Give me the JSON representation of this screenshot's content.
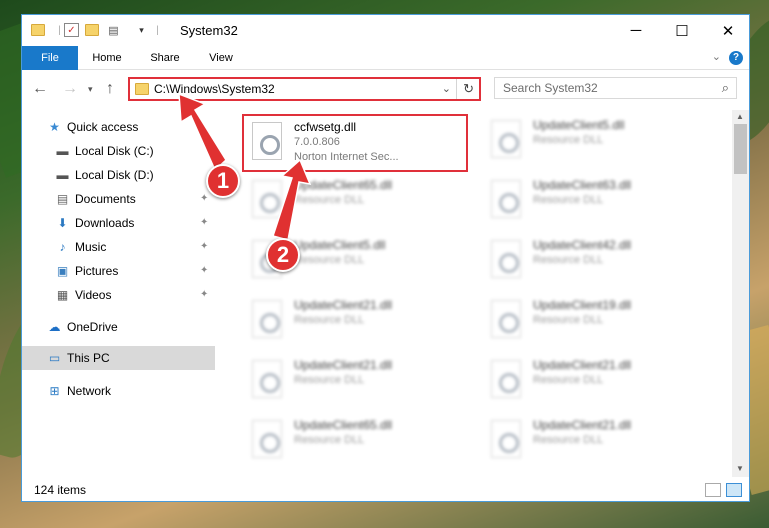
{
  "window": {
    "title": "System32",
    "controls": {
      "minimize": "─",
      "maximize": "☐",
      "close": "✕"
    }
  },
  "ribbon": {
    "tabs": [
      "File",
      "Home",
      "Share",
      "View"
    ],
    "help": "?"
  },
  "address_bar": {
    "path": "C:\\Windows\\System32"
  },
  "search": {
    "placeholder": "Search System32"
  },
  "navigation": {
    "items": [
      {
        "label": "Quick access",
        "icon": "star-icon",
        "pinned": false
      },
      {
        "label": "Local Disk (C:)",
        "icon": "drive-icon",
        "pinned": false
      },
      {
        "label": "Local Disk (D:)",
        "icon": "drive-icon",
        "pinned": false
      },
      {
        "label": "Documents",
        "icon": "documents-icon",
        "pinned": true
      },
      {
        "label": "Downloads",
        "icon": "download-icon",
        "pinned": true
      },
      {
        "label": "Music",
        "icon": "music-icon",
        "pinned": true
      },
      {
        "label": "Pictures",
        "icon": "pictures-icon",
        "pinned": true
      },
      {
        "label": "Videos",
        "icon": "video-icon",
        "pinned": true
      },
      {
        "label": "OneDrive",
        "icon": "cloud-icon",
        "pinned": false
      },
      {
        "label": "This PC",
        "icon": "computer-icon",
        "pinned": false,
        "selected": true
      },
      {
        "label": "Network",
        "icon": "network-icon",
        "pinned": false
      }
    ]
  },
  "files": [
    {
      "name": "ccfwsetg.dll",
      "version": "7.0.0.806",
      "description": "Norton Internet Sec...",
      "highlighted": true
    },
    {
      "name": "UpdateClient5.dll",
      "description": "Resource DLL"
    },
    {
      "name": "UpdateClient65.dll",
      "description": "Resource DLL"
    },
    {
      "name": "UpdateClient63.dll",
      "description": "Resource DLL"
    },
    {
      "name": "UpdateClient5.dll",
      "description": "Resource DLL"
    },
    {
      "name": "UpdateClient42.dll",
      "description": "Resource DLL"
    },
    {
      "name": "UpdateClient21.dll",
      "description": "Resource DLL"
    },
    {
      "name": "UpdateClient19.dll",
      "description": "Resource DLL"
    },
    {
      "name": "UpdateClient21.dll",
      "description": "Resource DLL"
    },
    {
      "name": "UpdateClient21.dll",
      "description": "Resource DLL"
    },
    {
      "name": "UpdateClient65.dll",
      "description": "Resource DLL"
    },
    {
      "name": "UpdateClient21.dll",
      "description": "Resource DLL"
    }
  ],
  "status_bar": {
    "item_count": "124 items"
  },
  "annotations": {
    "markers": [
      "1",
      "2"
    ],
    "color": "#e03131"
  }
}
